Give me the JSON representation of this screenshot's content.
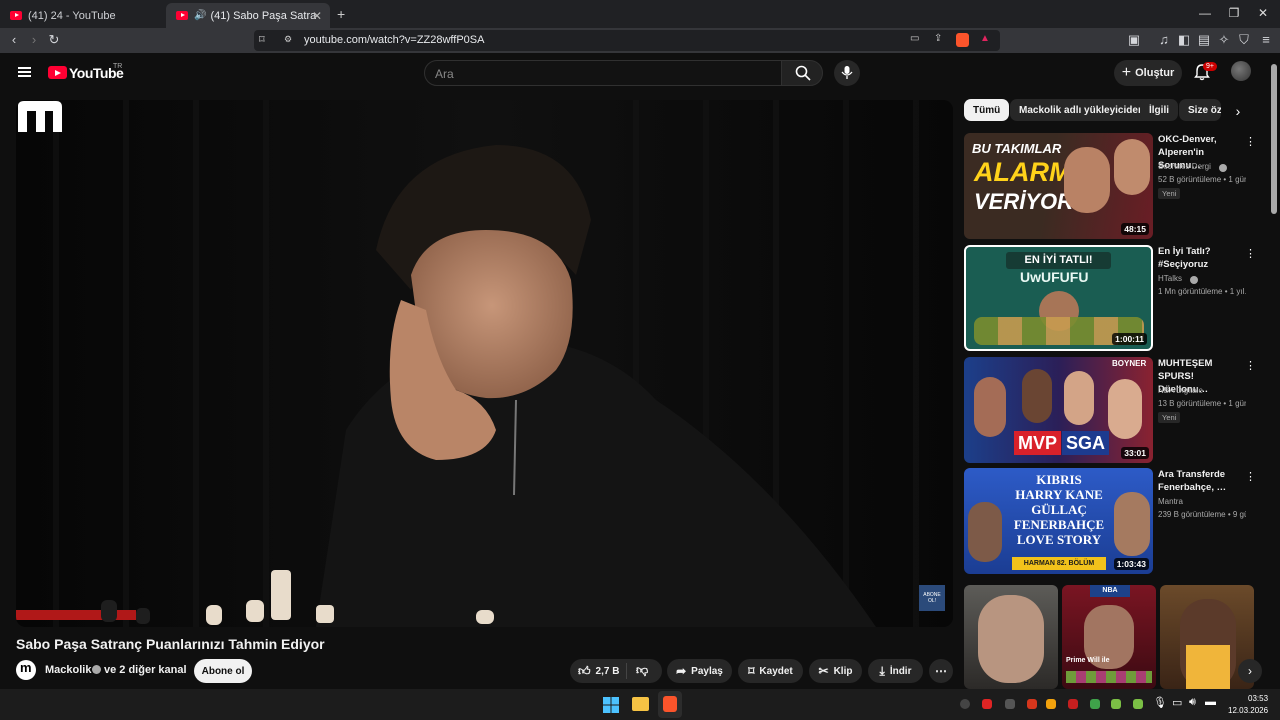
{
  "browser": {
    "tabs": [
      {
        "title": "(41) 24 - YouTube"
      },
      {
        "title": "(41) Sabo Paşa Satranç Puanl…"
      }
    ],
    "url": "youtube.com/watch?v=ZZ28wffP0SA"
  },
  "masthead": {
    "logo_text": "YouTube",
    "country": "TR",
    "search_placeholder": "Ara",
    "create_label": "Oluştur",
    "notifications": "9+"
  },
  "player": {
    "watermark_text": "ABONE OL!"
  },
  "video": {
    "title": "Sabo Paşa Satranç Puanlarınızı Tahmin Ediyor",
    "channel": "Mackolik",
    "channel_extra": "ve 2 diğer kanal",
    "subscribe_label": "Abone ol",
    "likes": "2,7 B",
    "share_label": "Paylaş",
    "save_label": "Kaydet",
    "clip_label": "Klip",
    "download_label": "İndir"
  },
  "chips": [
    "Tümü",
    "Mackolik adlı yükleyiciden",
    "İlgili",
    "Size öz"
  ],
  "recommendations": [
    {
      "title": "OKC-Denver, Alperen'in Sorunu…",
      "channel": "Socrates Dergi",
      "meta": "52 B görüntüleme • 1 gün…",
      "badge": "Yeni",
      "duration": "48:15",
      "thumb_text": [
        "BU TAKIMLAR",
        "ALARM",
        "VERİYOR"
      ]
    },
    {
      "title": "En İyi Tatlı? #Seçiyoruz",
      "channel": "HTalks",
      "meta": "1 Mn görüntüleme • 1 yıl…",
      "badge": "",
      "duration": "1:00:11",
      "thumb_text": [
        "EN İYİ TATLI!",
        "UwUFUFU"
      ]
    },
    {
      "title": "MUHTEŞEM SPURS! Düellonu…",
      "channel": "NBA Digitale",
      "meta": "13 B görüntüleme • 1 gün…",
      "badge": "Yeni",
      "duration": "33:01",
      "thumb_text": [
        "MVP",
        "SGA",
        "BOYNER"
      ]
    },
    {
      "title": "Ara Transferde Fenerbahçe, …",
      "channel": "Mantra",
      "meta": "239 B görüntüleme • 9 gü…",
      "badge": "",
      "duration": "1:03:43",
      "thumb_text": [
        "KIBRIS",
        "HARRY KANE",
        "GÜLLAÇ",
        "FENERBAHÇE",
        "LOVE STORY",
        "HARMAN 82. BÖLÜM"
      ]
    }
  ],
  "shorts": [
    {
      "caption": ""
    },
    {
      "caption": "Prime Will ile"
    },
    {
      "caption": ""
    }
  ],
  "taskbar": {
    "time": "03:53",
    "date": "12.03.2026"
  },
  "colors": {
    "accent_red": "#ff0033",
    "background": "#0f0f0f",
    "chip_bg": "#272727"
  }
}
